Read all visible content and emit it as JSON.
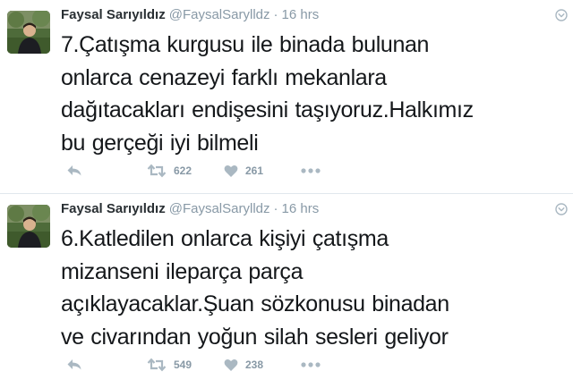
{
  "tweets": [
    {
      "fullname": "Faysal Sarıyıldız",
      "username": "@FaysalSarylldz",
      "separator": "·",
      "time": "16 hrs",
      "text": "7.Çatışma kurgusu ile binada bulunan\nonlarca cenazeyi farklı mekanlara\ndağıtacakları endişesini taşıyoruz.Halkımız\nbu gerçeği iyi bilmeli",
      "retweets": "622",
      "likes": "261"
    },
    {
      "fullname": "Faysal Sarıyıldız",
      "username": "@FaysalSarylldz",
      "separator": "·",
      "time": "16 hrs",
      "text": "6.Katledilen onlarca kişiyi çatışma\nmizanseni ileparça parça\naçıklayacaklar.Şuan sözkonusu binadan\nve civarından yoğun silah sesleri geliyor",
      "retweets": "549",
      "likes": "238"
    }
  ],
  "icons": {
    "reply": "reply-icon",
    "retweet": "retweet-icon",
    "like": "heart-icon",
    "more": "more-dots-icon",
    "caret": "chevron-down-icon"
  },
  "colors": {
    "text": "#14171a",
    "muted": "#8899a6",
    "icon": "#aab8c2",
    "divider": "#e1e8ed"
  }
}
